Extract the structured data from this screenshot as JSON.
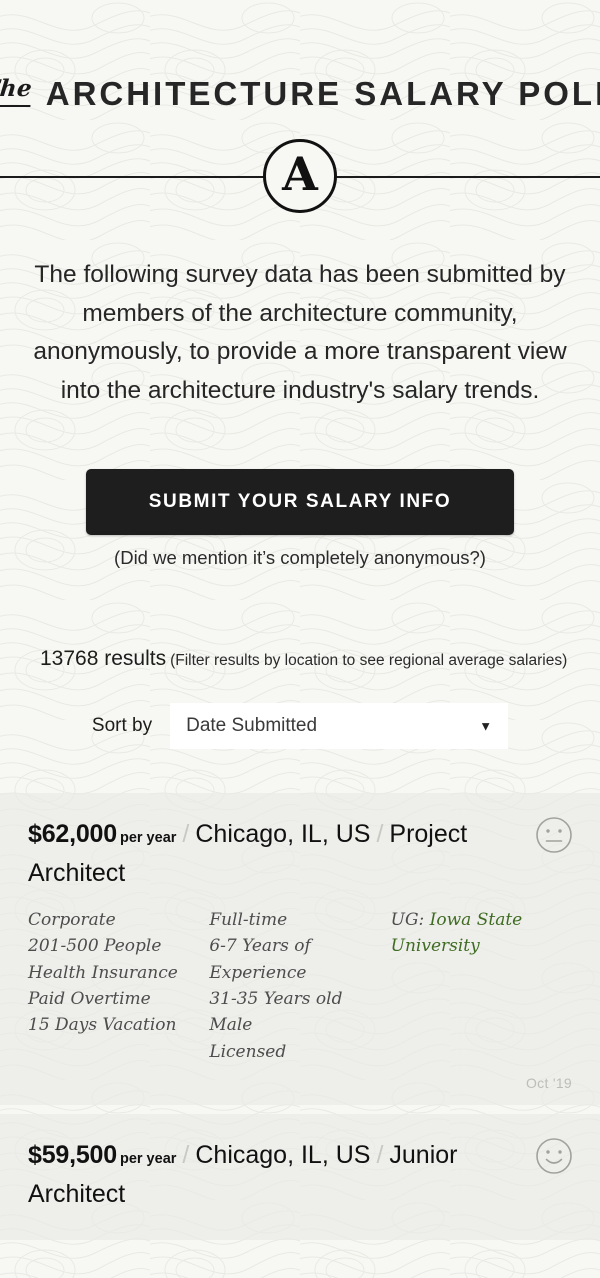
{
  "masthead": {
    "the": "The",
    "title": "ARCHITECTURE SALARY POLL",
    "logo_letter": "A"
  },
  "intro": {
    "text": "The following survey data has been submitted by members of the architecture community, anonymously, to provide a more transparent view into the architecture industry's salary trends."
  },
  "cta": {
    "button_label": "SUBMIT YOUR SALARY INFO",
    "note": "(Did we mention it’s completely anonymous?)"
  },
  "results_bar": {
    "count_label": "13768 results",
    "hint": "(Filter results by location to see regional average salaries)"
  },
  "sort": {
    "label": "Sort by",
    "value": "Date Submitted",
    "caret": "▼",
    "options": [
      "Date Submitted"
    ]
  },
  "colors": {
    "page_bg": "#f7f7f4",
    "card_bg": "#e9e9e5",
    "button_bg": "#1e1e1e",
    "school_green": "#3f6c22",
    "mood_gray": "#9a9a95",
    "date_gray": "#bdbdb8"
  },
  "results": [
    {
      "salary": "$62,000",
      "per": "per year",
      "location": "Chicago, IL, US",
      "job_title": "Project Architect",
      "mood": "neutral-face-icon",
      "col1": [
        "Corporate",
        "201-500 People",
        "Health Insurance",
        "Paid Overtime",
        "15 Days Vacation"
      ],
      "col2": [
        "Full-time",
        "6-7 Years of Experience",
        "31-35 Years old",
        "Male",
        "Licensed"
      ],
      "ug_label": "UG:",
      "ug_school": "Iowa State University",
      "date": "Oct '19"
    },
    {
      "salary": "$59,500",
      "per": "per year",
      "location": "Chicago, IL, US",
      "job_title": "Junior Architect",
      "mood": "smiley-face-icon",
      "col1": [],
      "col2": [],
      "ug_label": "",
      "ug_school": "",
      "date": ""
    }
  ]
}
